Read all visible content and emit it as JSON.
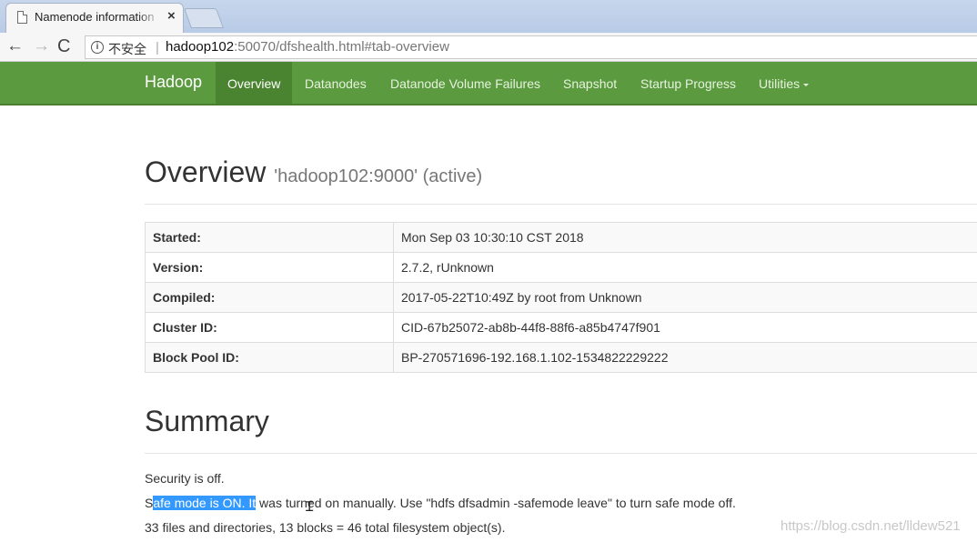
{
  "browser": {
    "tab_title": "Namenode information",
    "tab_close": "×",
    "insecure_label": "不安全",
    "separator": "|",
    "url_host": "hadoop102",
    "url_path": ":50070/dfshealth.html#tab-overview",
    "icons": {
      "back": "←",
      "forward": "→",
      "reload": "C",
      "info": "i"
    }
  },
  "navbar": {
    "brand": "Hadoop",
    "items": [
      {
        "label": "Overview",
        "active": true
      },
      {
        "label": "Datanodes"
      },
      {
        "label": "Datanode Volume Failures"
      },
      {
        "label": "Snapshot"
      },
      {
        "label": "Startup Progress"
      },
      {
        "label": "Utilities"
      }
    ],
    "colors": {
      "bar": "#5b9a3e",
      "active": "#4a8431"
    }
  },
  "overview": {
    "title": "Overview",
    "subtitle": "'hadoop102:9000' (active)",
    "rows": [
      {
        "key": "Started:",
        "value": "Mon Sep 03 10:30:10 CST 2018"
      },
      {
        "key": "Version:",
        "value": "2.7.2, rUnknown"
      },
      {
        "key": "Compiled:",
        "value": "2017-05-22T10:49Z by root from Unknown"
      },
      {
        "key": "Cluster ID:",
        "value": "CID-67b25072-ab8b-44f8-88f6-a85b4747f901"
      },
      {
        "key": "Block Pool ID:",
        "value": "BP-270571696-192.168.1.102-1534822229222"
      }
    ]
  },
  "summary": {
    "title": "Summary",
    "security": "Security is off.",
    "safemode_pre": "S",
    "safemode_selected": "afe mode is ON. It",
    "safemode_post": " was turned on manually. Use \"hdfs dfsadmin -safemode leave\" to turn safe mode off.",
    "filesystem": "33 files and directories, 13 blocks = 46 total filesystem object(s)."
  },
  "watermark": "https://blog.csdn.net/lldew521"
}
